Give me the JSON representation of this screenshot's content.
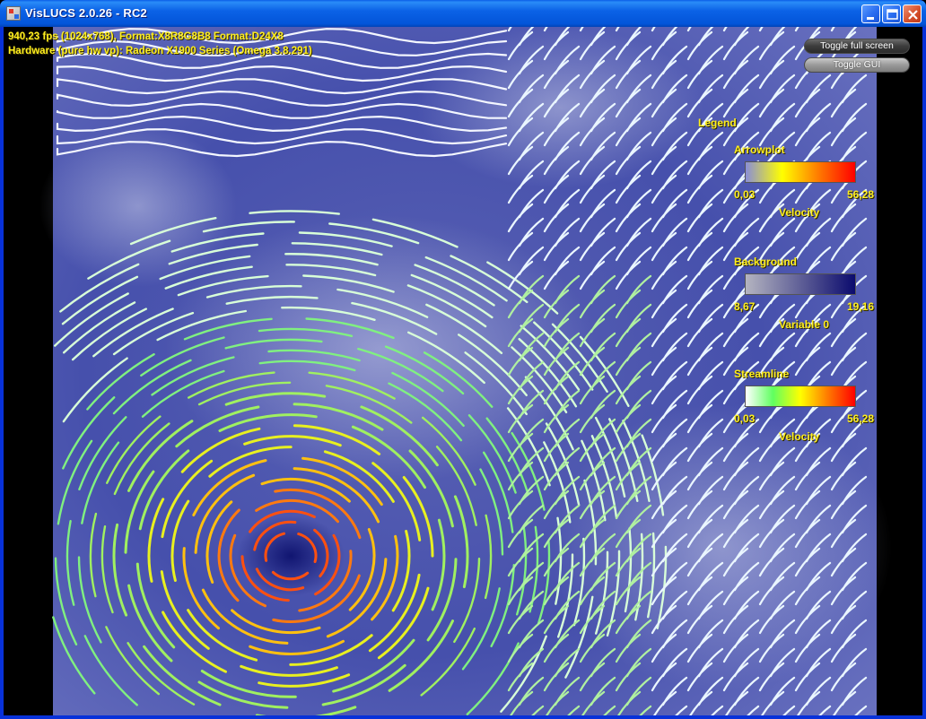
{
  "window": {
    "title": "VisLUCS 2.0.26 - RC2",
    "controls": [
      "minimize",
      "maximize",
      "close"
    ]
  },
  "info": {
    "line1": "940,23 fps (1024x768), Format:X8R8G8B8 Format:D24X8",
    "line2": "Hardware (pure hw vp): Radeon X1900 Series (Omega 3.8.291)"
  },
  "buttons": {
    "fullscreen": "Toggle full screen",
    "gui": "Toggle GUI"
  },
  "legend": {
    "title": "Legend",
    "entries": [
      {
        "heading": "Arrowplot",
        "min": "0,03",
        "max": "56,28",
        "variable": "Velocity",
        "colors": [
          "#8a8ed8",
          "#ffff00",
          "#ff7a00",
          "#ff0000"
        ]
      },
      {
        "heading": "Background",
        "min": "8,67",
        "max": "19,16",
        "variable": "Variable 0",
        "colors": [
          "#b4b4c0",
          "#0b0b6e"
        ]
      },
      {
        "heading": "Streamline",
        "min": "0,03",
        "max": "56,28",
        "variable": "Velocity",
        "colors": [
          "#ffffff",
          "#60ff60",
          "#ffff00",
          "#ff7a00",
          "#ff0000"
        ]
      }
    ]
  },
  "colors": {
    "text_accent": "#ffef1e",
    "field_background": "#4049a8",
    "titlebar": "#0355d9"
  }
}
